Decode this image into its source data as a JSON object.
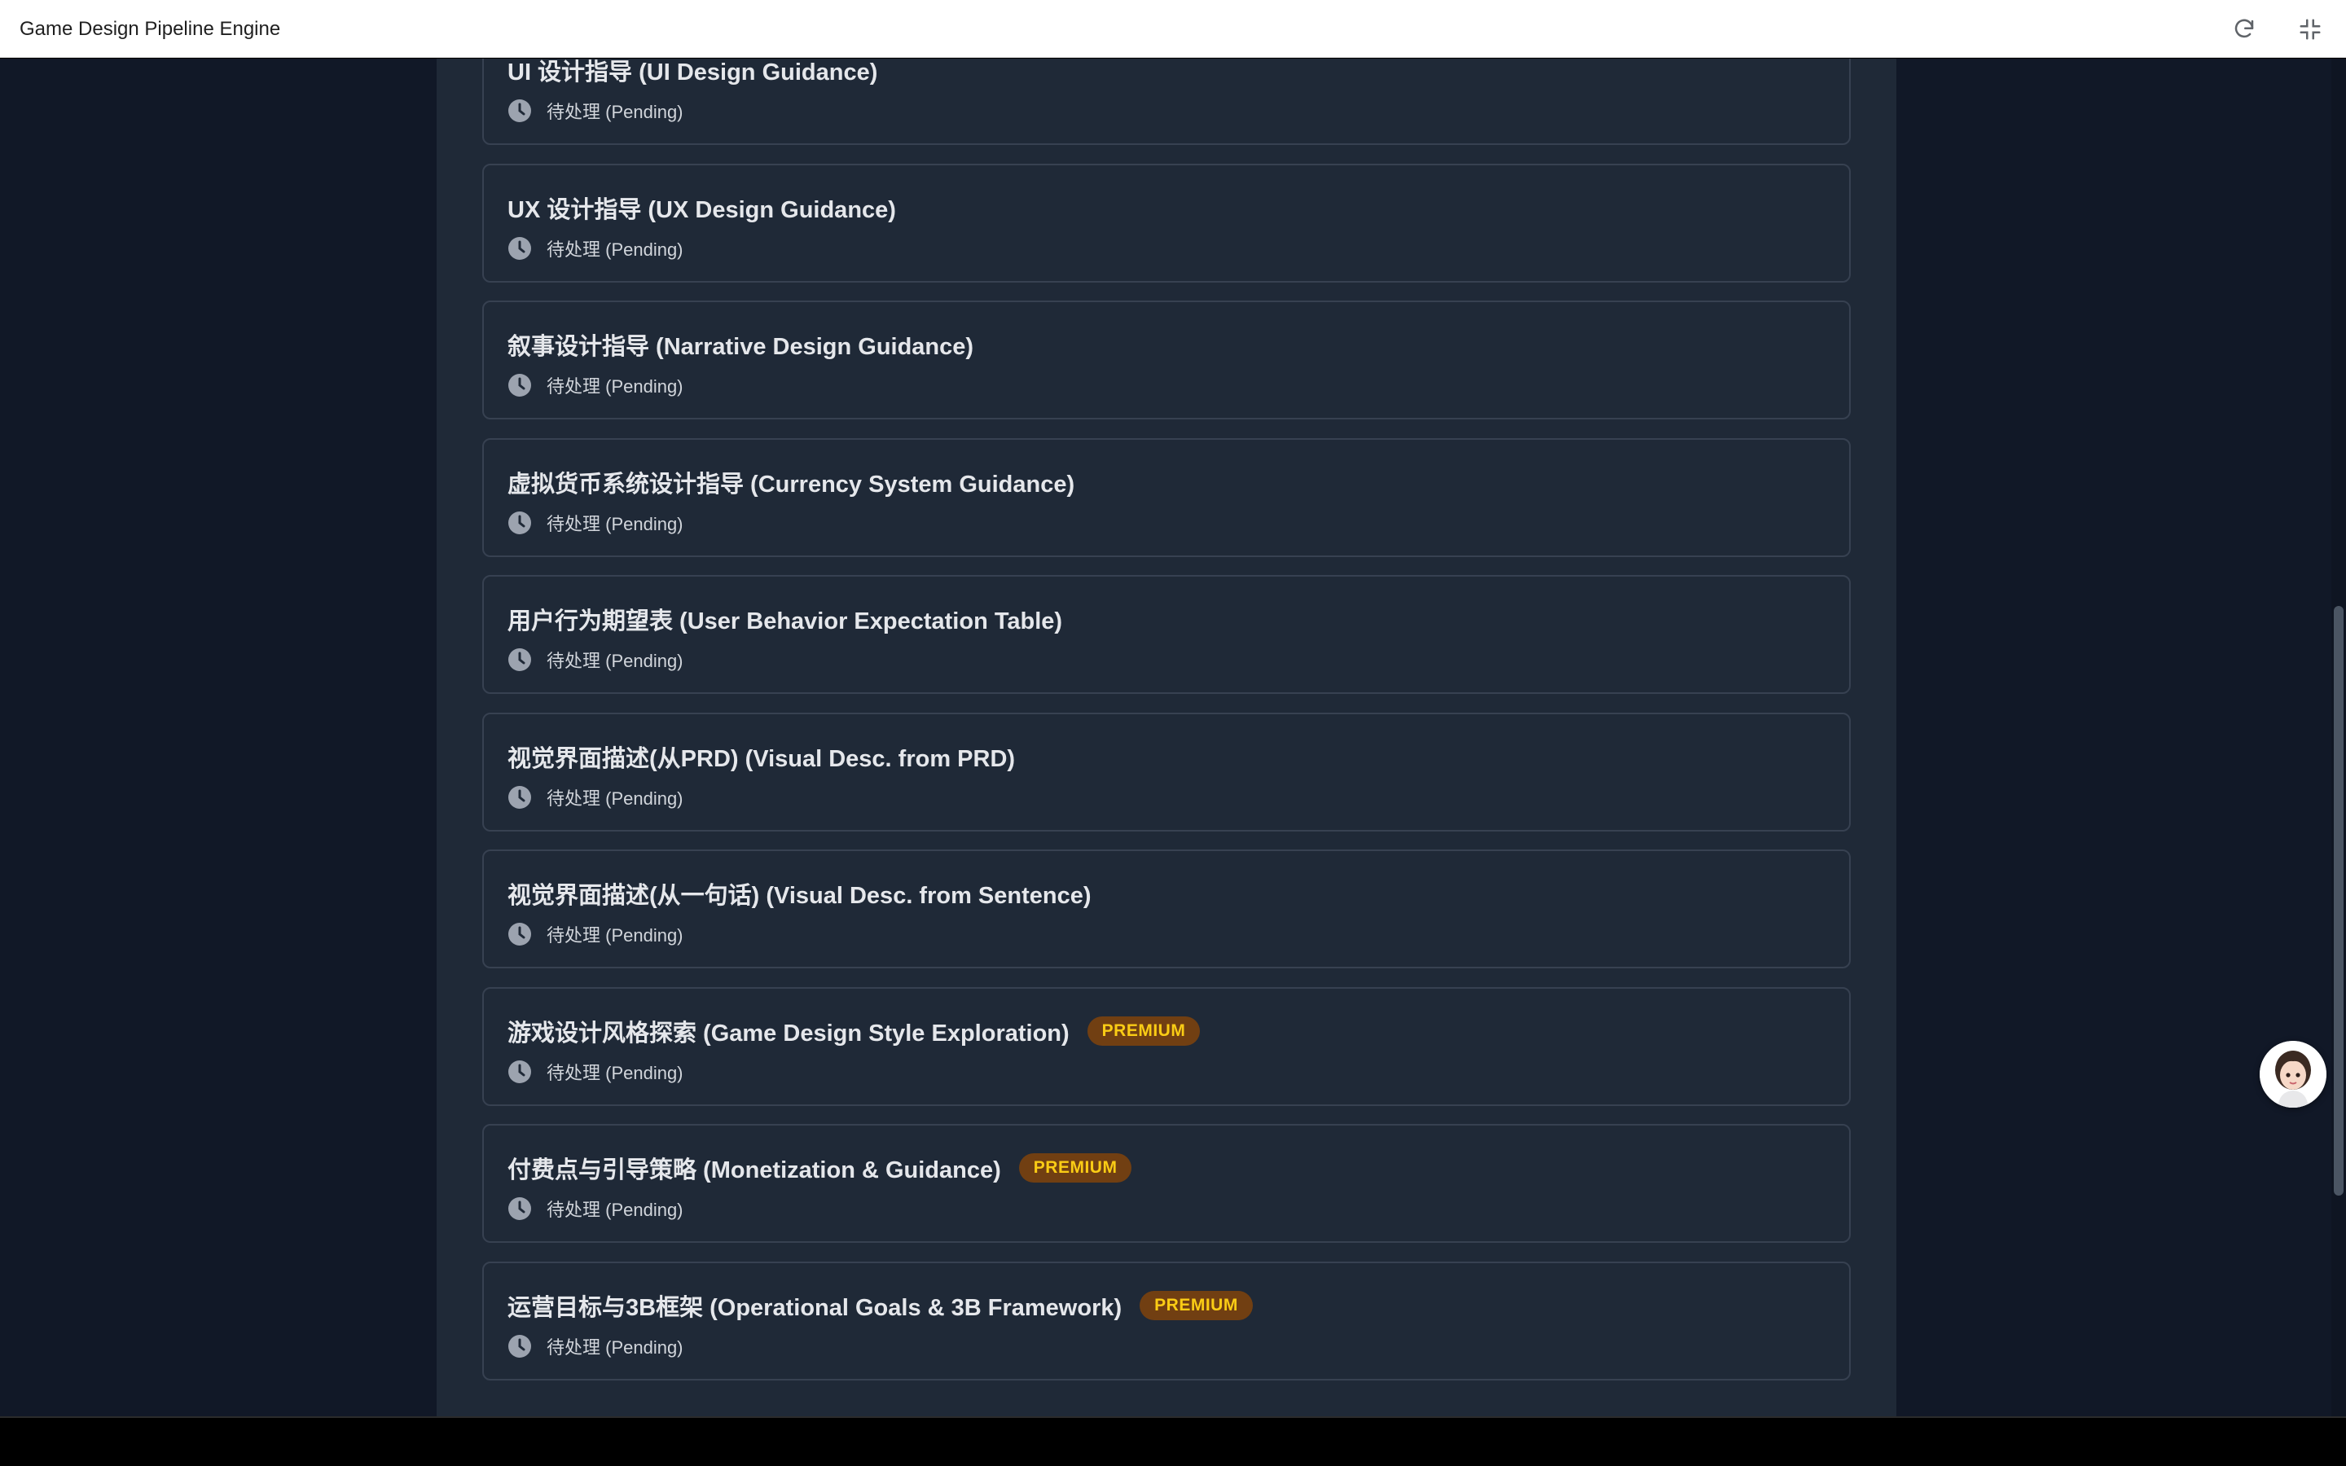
{
  "window": {
    "title": "Game Design Pipeline Engine"
  },
  "colors": {
    "page_bg": "#111827",
    "panel_bg": "#1f2937",
    "card_border": "#374151",
    "badge_bg": "#713f12",
    "badge_text": "#facc15"
  },
  "icons": {
    "refresh": "refresh-icon",
    "collapse": "collapse-icon",
    "status": "clock-icon",
    "assistant": "assistant-avatar"
  },
  "tasks": [
    {
      "title": "UI 设计指导 (UI Design Guidance)",
      "status": "待处理 (Pending)",
      "badge": ""
    },
    {
      "title": "UX 设计指导 (UX Design Guidance)",
      "status": "待处理 (Pending)",
      "badge": ""
    },
    {
      "title": "叙事设计指导 (Narrative Design Guidance)",
      "status": "待处理 (Pending)",
      "badge": ""
    },
    {
      "title": "虚拟货币系统设计指导 (Currency System Guidance)",
      "status": "待处理 (Pending)",
      "badge": ""
    },
    {
      "title": "用户行为期望表 (User Behavior Expectation Table)",
      "status": "待处理 (Pending)",
      "badge": ""
    },
    {
      "title": "视觉界面描述(从PRD) (Visual Desc. from PRD)",
      "status": "待处理 (Pending)",
      "badge": ""
    },
    {
      "title": "视觉界面描述(从一句话) (Visual Desc. from Sentence)",
      "status": "待处理 (Pending)",
      "badge": ""
    },
    {
      "title": "游戏设计风格探索 (Game Design Style Exploration)",
      "status": "待处理 (Pending)",
      "badge": "PREMIUM"
    },
    {
      "title": "付费点与引导策略 (Monetization & Guidance)",
      "status": "待处理 (Pending)",
      "badge": "PREMIUM"
    },
    {
      "title": "运营目标与3B框架 (Operational Goals & 3B Framework)",
      "status": "待处理 (Pending)",
      "badge": "PREMIUM"
    }
  ]
}
